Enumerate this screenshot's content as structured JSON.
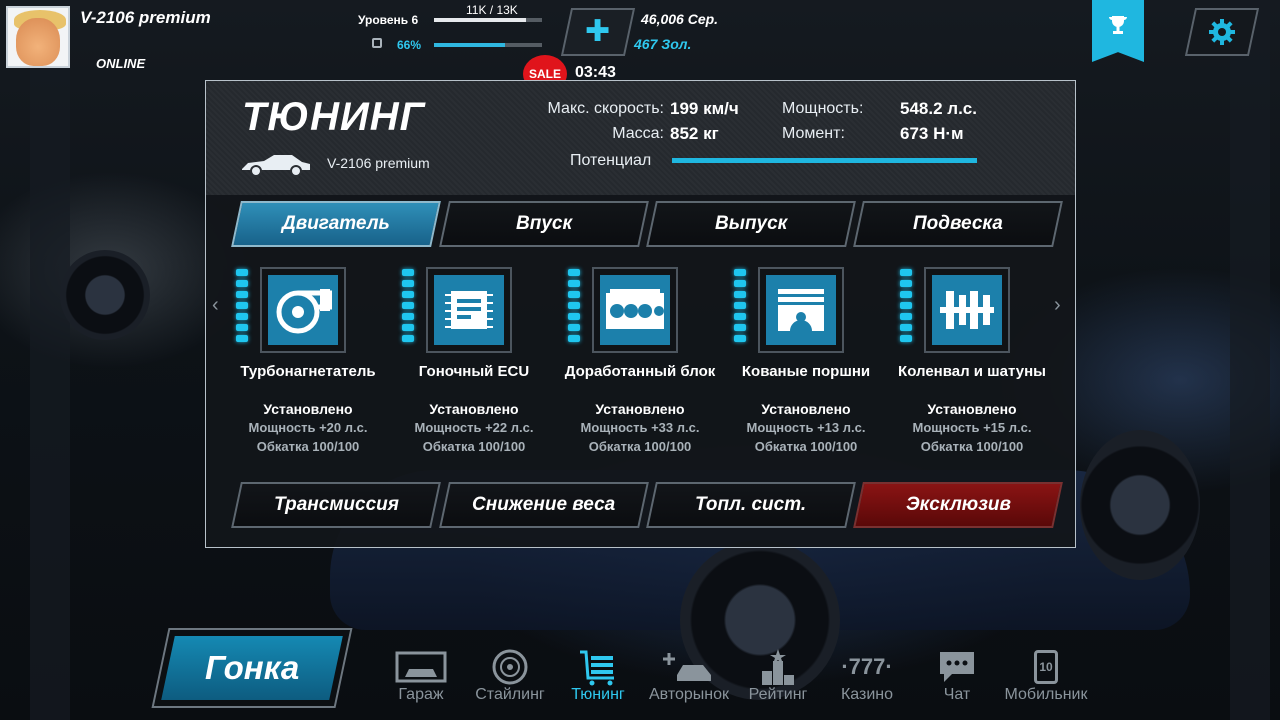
{
  "profile": {
    "name": "V-2106 premium",
    "status": "ONLINE"
  },
  "progress": {
    "level_label": "Уровень 6",
    "xp_text": "11K / 13K",
    "xp_fraction": 0.85,
    "fuel_text": "66%",
    "fuel_fraction": 0.66
  },
  "currency": {
    "silver": "46,006 Сер.",
    "gold": "467 Зол.",
    "add_icon": "plus-icon"
  },
  "sale": {
    "badge": "SALE",
    "timer": "03:43"
  },
  "top_right": {
    "trophy_icon": "trophy-icon",
    "settings_icon": "gear-icon"
  },
  "tuning": {
    "title": "ТЮНИНГ",
    "car_name": "V-2106 premium",
    "stats": {
      "max_speed_label": "Макс. скорость:",
      "max_speed_value": "199 км/ч",
      "mass_label": "Масса:",
      "mass_value": "852 кг",
      "power_label": "Мощность:",
      "power_value": "548.2 л.с.",
      "torque_label": "Момент:",
      "torque_value": "673 Н·м",
      "potential_label": "Потенциал",
      "potential_fraction": 1.0
    },
    "top_tabs": [
      "Двигатель",
      "Впуск",
      "Выпуск",
      "Подвеска"
    ],
    "active_tab": "Двигатель",
    "bottom_tabs": [
      "Трансмиссия",
      "Снижение веса",
      "Топл. сист.",
      "Эксклюзив"
    ],
    "parts": [
      {
        "name": "Турбонагнетатель",
        "status": "Установлено",
        "power": "Мощность +20 л.с.",
        "wear": "Обкатка 100/100",
        "icon": "turbo-icon"
      },
      {
        "name": "Гоночный ECU",
        "status": "Установлено",
        "power": "Мощность +22 л.с.",
        "wear": "Обкатка 100/100",
        "icon": "ecu-chip-icon"
      },
      {
        "name": "Доработанный блок",
        "status": "Установлено",
        "power": "Мощность +33 л.с.",
        "wear": "Обкатка 100/100",
        "icon": "engine-block-icon"
      },
      {
        "name": "Кованые поршни",
        "status": "Установлено",
        "power": "Мощность +13 л.с.",
        "wear": "Обкатка 100/100",
        "icon": "piston-icon"
      },
      {
        "name": "Коленвал и шатуны",
        "status": "Установлено",
        "power": "Мощность +15 л.с.",
        "wear": "Обкатка 100/100",
        "icon": "crankshaft-icon"
      }
    ]
  },
  "bottom": {
    "race_label": "Гонка",
    "nav": [
      {
        "label": "Гараж",
        "icon": "garage-icon"
      },
      {
        "label": "Стайлинг",
        "icon": "wheel-icon"
      },
      {
        "label": "Тюнинг",
        "icon": "tuning-cart-icon"
      },
      {
        "label": "Авторынок",
        "icon": "car-market-icon"
      },
      {
        "label": "Рейтинг",
        "icon": "rating-icon"
      },
      {
        "label": "Казино",
        "icon": "casino-icon",
        "glyph": "·777·"
      },
      {
        "label": "Чат",
        "icon": "chat-icon"
      },
      {
        "label": "Мобильник",
        "icon": "phone-icon",
        "badge": "10"
      }
    ],
    "active_nav": "Тюнинг"
  },
  "colors": {
    "accent": "#1fb7e0",
    "sale_red": "#e0141b",
    "exclusive_red": "#8a1414"
  }
}
